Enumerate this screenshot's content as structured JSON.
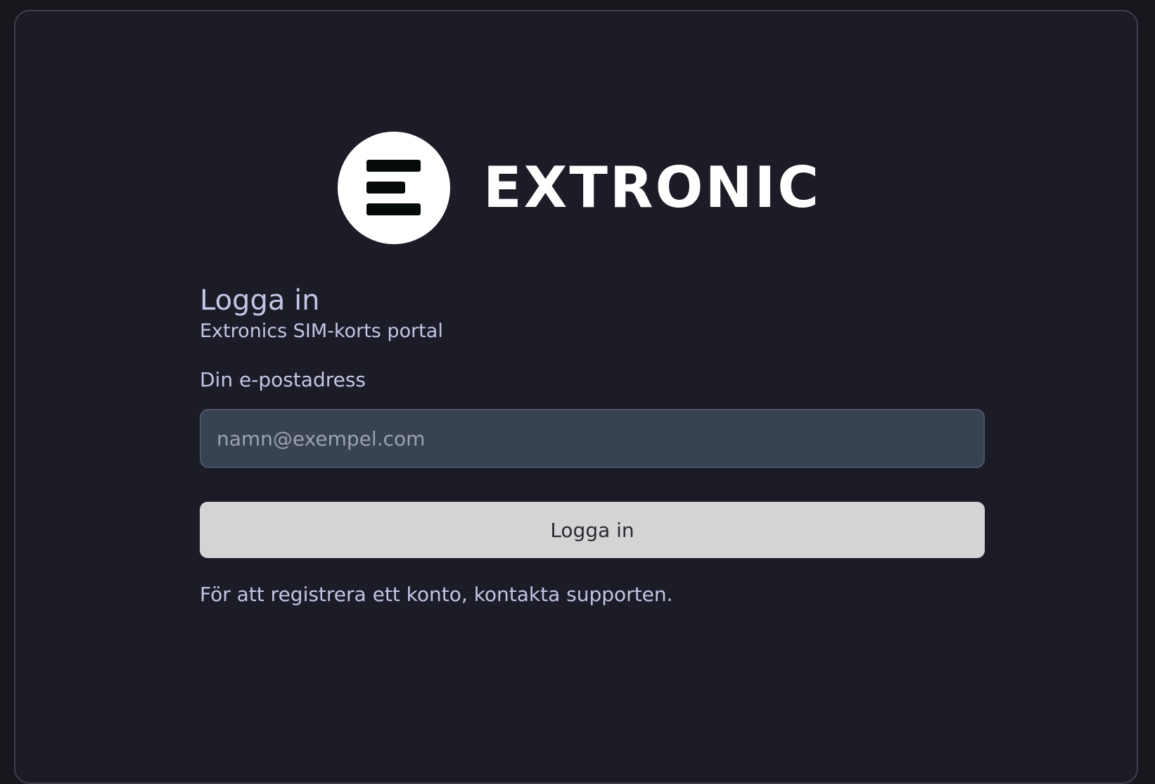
{
  "brand": {
    "name": "EXTRONIC",
    "logo_icon": "extronic-e-logo-icon"
  },
  "login": {
    "title": "Logga in",
    "subtitle": "Extronics SIM-korts portal",
    "email_label": "Din e-postadress",
    "email_placeholder": "namn@exempel.com",
    "email_value": "",
    "submit_label": "Logga in",
    "register_note": "För att registrera ett konto, kontakta supporten."
  },
  "colors": {
    "page_background": "#17171d",
    "card_background": "#1c1c26",
    "card_border": "#3d3f4c",
    "text_accent": "#c3c5e8",
    "input_background": "#394252",
    "button_background": "#d4d4d4",
    "button_text": "#2a2a33"
  }
}
